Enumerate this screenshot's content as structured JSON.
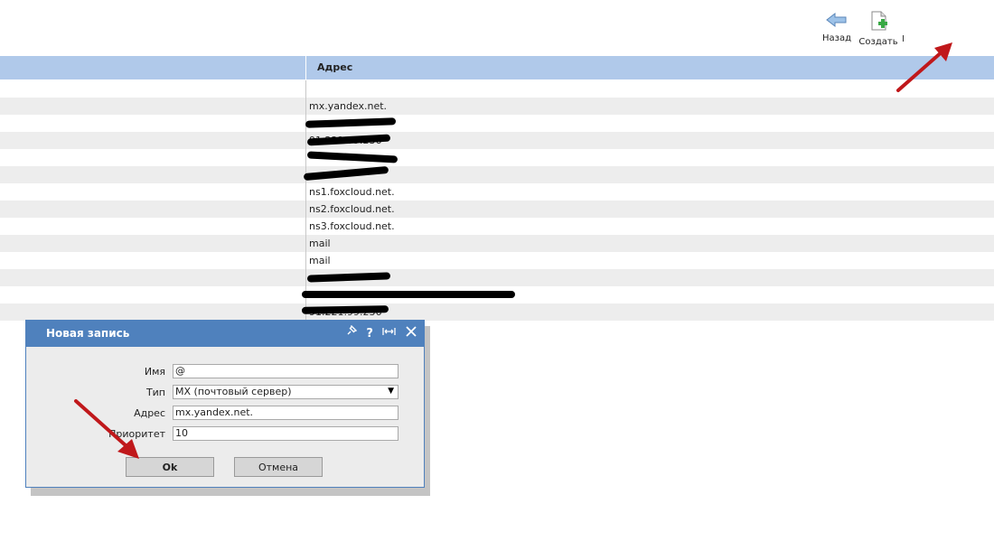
{
  "toolbar": {
    "back_label": "Назад",
    "create_label": "Создать",
    "cut_label": "I"
  },
  "grid": {
    "column_title": "Адрес",
    "rows": [
      "",
      "mx.yandex.net.",
      "",
      "91.221.99.236",
      "",
      "",
      "ns1.foxcloud.net.",
      "ns2.foxcloud.net.",
      "ns3.foxcloud.net.",
      "mail",
      "mail",
      "",
      "",
      "91.221.99.236"
    ]
  },
  "dialog": {
    "title": "Новая запись",
    "tools": [
      "pin-icon",
      "help-icon",
      "resize-icon",
      "close-icon"
    ],
    "fields": {
      "name_label": "Имя",
      "name_value": "@",
      "type_label": "Тип",
      "type_value": "MX (почтовый сервер)",
      "address_label": "Адрес",
      "address_value": "mx.yandex.net.",
      "priority_label": "Приоритет",
      "priority_value": "10"
    },
    "ok_label": "Ok",
    "cancel_label": "Отмена"
  },
  "colors": {
    "header_bg": "#b0c9ea",
    "dialog_title_bg": "#4f81bd",
    "row_alt": "#ededed",
    "annotation_arrow": "#c0181b"
  }
}
